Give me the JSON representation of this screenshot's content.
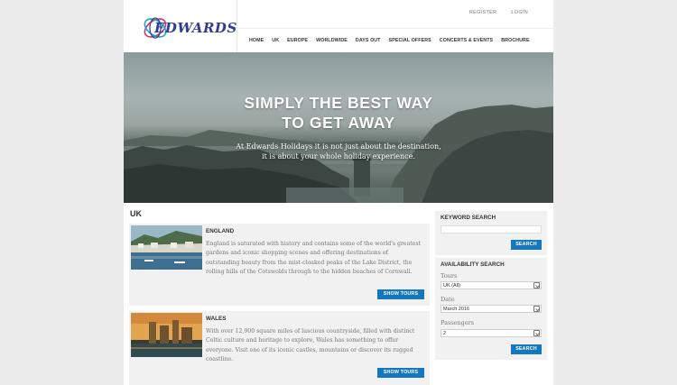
{
  "header": {
    "logo_text": "EDWARDS",
    "util_links": [
      "REGISTER",
      "LOGIN"
    ],
    "nav": [
      "HOME",
      "UK",
      "EUROPE",
      "WORLDWIDE",
      "DAYS OUT",
      "SPECIAL OFFERS",
      "CONCERTS & EVENTS",
      "BROCHURE"
    ]
  },
  "hero": {
    "title_line1": "SIMPLY THE BEST WAY",
    "title_line2": "TO GET AWAY",
    "subtitle_line1": "At Edwards Holidays it is not just about the destination,",
    "subtitle_line2": "it is about your whole holiday experience."
  },
  "main": {
    "section_title": "UK",
    "cards": [
      {
        "title": "ENGLAND",
        "description": "England is saturated with history and contains some of the world's greatest gardens and iconic shopping scenes and offering destinations of outstanding beauty from the mist-cloaked peaks of the Lake District, the rolling hills of the Cotswolds through to the hidden beaches of Cornwall.",
        "button": "SHOW TOURS"
      },
      {
        "title": "WALES",
        "description": "With over 12,900 square miles of luscious countryside, filled with distinct Celtic culture and heritage to explore, Wales has something to offer everyone. Visit one of its iconic castles, mountains or discover its rugged coastline.",
        "button": "SHOW TOURS"
      }
    ]
  },
  "sidebar": {
    "keyword": {
      "title": "KEYWORD SEARCH",
      "value": "",
      "button": "SEARCH"
    },
    "availability": {
      "title": "AVAILABILITY SEARCH",
      "tours_label": "Tours",
      "tours_value": "UK (All)",
      "date_label": "Date",
      "date_value": "March 2016",
      "passengers_label": "Passengers",
      "passengers_value": "2",
      "button": "SEARCH"
    }
  },
  "colors": {
    "brand_blue": "#2e3d8f",
    "button_blue": "#1477c0",
    "logo_pink": "#d6336c",
    "logo_cyan": "#17a5d6"
  }
}
